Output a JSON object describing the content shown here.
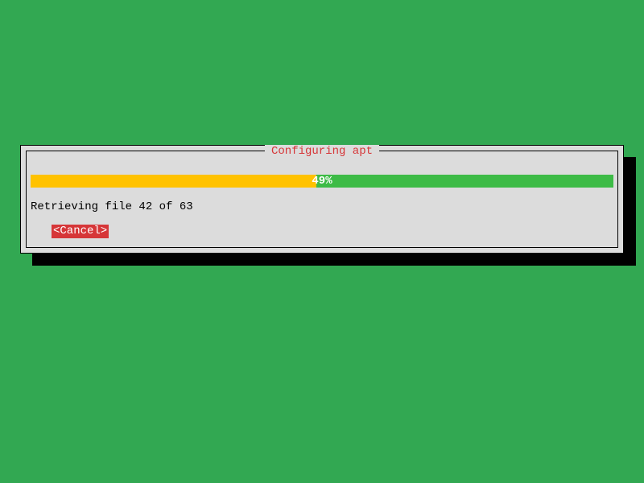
{
  "dialog": {
    "title": "Configuring apt",
    "progress": {
      "percent": 49,
      "label": "49%"
    },
    "status": "Retrieving file 42 of 63",
    "cancel_label": "<Cancel>"
  },
  "colors": {
    "background": "#32a852",
    "dialog_bg": "#dcdcdc",
    "title_fg": "#d63638",
    "progress_filled": "#ffc200",
    "progress_empty": "#3dbb46",
    "button_bg": "#d63638",
    "button_fg": "#ffffff"
  }
}
